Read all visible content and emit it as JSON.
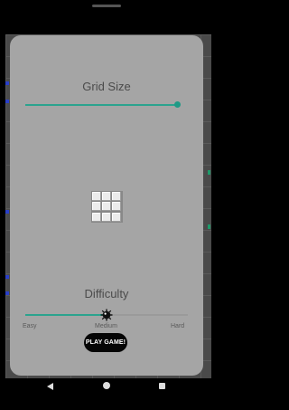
{
  "dialog": {
    "grid_size": {
      "title": "Grid Size",
      "slider_value": 1.0
    },
    "grid_preview": {
      "rows": 3,
      "cols": 3
    },
    "difficulty": {
      "title": "Difficulty",
      "labels": [
        "Easy",
        "Medium",
        "Hard"
      ],
      "slider_value": 0.5,
      "thumb_icon": "mine-icon"
    },
    "play_button_label": "PLAY GAME!"
  },
  "nav_bar": {
    "icons": [
      "back-icon",
      "home-icon",
      "recent-apps-icon"
    ]
  },
  "colors": {
    "accent": "#2ba38e",
    "dialog_bg": "#a5a5a5",
    "button_bg": "#050505"
  }
}
